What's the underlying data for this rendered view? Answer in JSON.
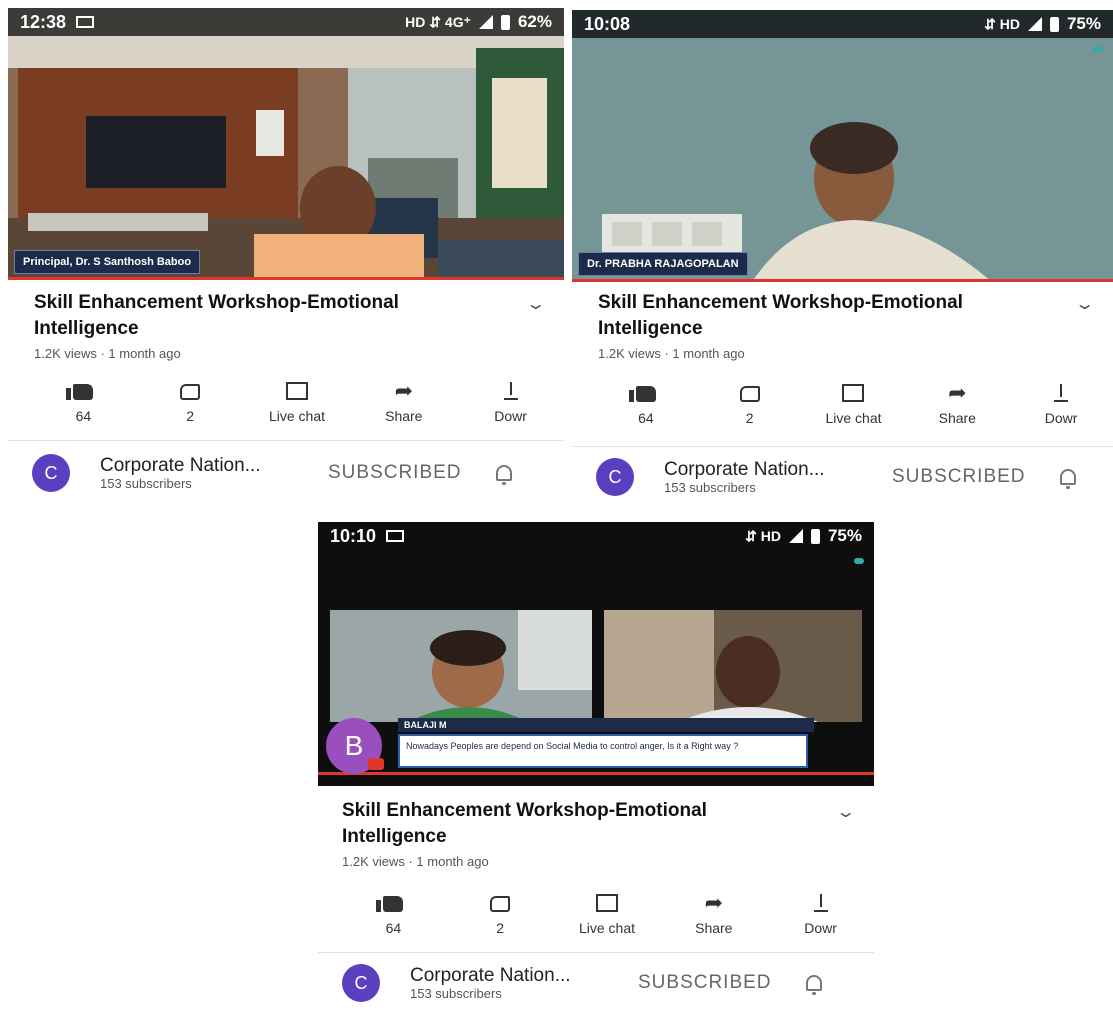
{
  "panels": [
    {
      "status": {
        "time": "12:38",
        "icons": "HD ⇵ 4G⁺",
        "battery": "62%"
      },
      "name_tag": "Principal, Dr. S Santhosh Baboo",
      "title": "Skill Enhancement Workshop-Emotional Intelligence",
      "meta": "1.2K views · 1 month ago",
      "actions": [
        {
          "icon": "thumb-up-icon",
          "label": "64"
        },
        {
          "icon": "thumb-down-icon",
          "label": "2"
        },
        {
          "icon": "live-chat-icon",
          "label": "Live chat"
        },
        {
          "icon": "share-icon",
          "label": "Share"
        },
        {
          "icon": "download-icon",
          "label": "Dowr"
        }
      ],
      "channel": {
        "avatar": "C",
        "name": "Corporate Nation...",
        "subs": "153 subscribers",
        "subscribed": "SUBSCRIBED"
      }
    },
    {
      "status": {
        "time": "10:08",
        "icons": "⇵ HD",
        "battery": "75%"
      },
      "name_tag": "Dr. PRABHA RAJAGOPALAN",
      "title": "Skill Enhancement Workshop-Emotional Intelligence",
      "meta": "1.2K views · 1 month ago",
      "actions": [
        {
          "icon": "thumb-up-icon",
          "label": "64"
        },
        {
          "icon": "thumb-down-icon",
          "label": "2"
        },
        {
          "icon": "live-chat-icon",
          "label": "Live chat"
        },
        {
          "icon": "share-icon",
          "label": "Share"
        },
        {
          "icon": "download-icon",
          "label": "Dowr"
        }
      ],
      "channel": {
        "avatar": "C",
        "name": "Corporate Nation...",
        "subs": "153 subscribers",
        "subscribed": "SUBSCRIBED"
      }
    },
    {
      "status": {
        "time": "10:10",
        "icons": "⇵ HD",
        "battery": "75%"
      },
      "comment": {
        "avatar": "B",
        "author": "BALAJI M",
        "text": "Nowadays Peoples are depend on Social Media to control anger, Is it a Right way ?"
      },
      "title": "Skill Enhancement Workshop-Emotional Intelligence",
      "meta": "1.2K views · 1 month ago",
      "actions": [
        {
          "icon": "thumb-up-icon",
          "label": "64"
        },
        {
          "icon": "thumb-down-icon",
          "label": "2"
        },
        {
          "icon": "live-chat-icon",
          "label": "Live chat"
        },
        {
          "icon": "share-icon",
          "label": "Share"
        },
        {
          "icon": "download-icon",
          "label": "Dowr"
        }
      ],
      "channel": {
        "avatar": "C",
        "name": "Corporate Nation...",
        "subs": "153 subscribers",
        "subscribed": "SUBSCRIBED"
      }
    }
  ],
  "colors": {
    "accent_red": "#e0362c",
    "channel_avatar": "#5a3fc0",
    "comment_avatar": "#9b4fbf"
  }
}
